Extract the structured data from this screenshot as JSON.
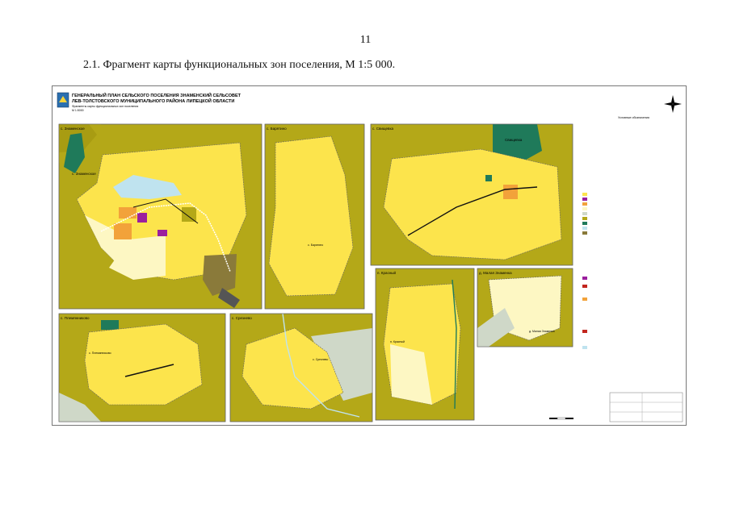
{
  "page_number": "11",
  "caption": "2.1.    Фрагмент карты функциональных зон поселения, М 1:5 000.",
  "header": {
    "line1": "ГЕНЕРАЛЬНЫЙ ПЛАН СЕЛЬСКОГО ПОСЕЛЕНИЯ ЗНАМЕНСКИЙ СЕЛЬСОВЕТ",
    "line2": "ЛЕВ-ТОЛСТОВСКОГО МУНИЦИПАЛЬНОГО РАЙОНА ЛИПЕЦКОЙ ОБЛАСТИ",
    "line3": "Фрагменты карты функциональных зон поселения",
    "line4": "М 1:5000"
  },
  "panels": {
    "znamenskoe": {
      "title": "с. Знаменское",
      "label": "с. Знаменское"
    },
    "baryatino": {
      "title": "с. Барятино",
      "label": "с. Барятино"
    },
    "svishchevka": {
      "title": "с. Свищевка",
      "label": "Свищевка"
    },
    "krasnyi": {
      "title": "п. Красный",
      "label": "п. Красный"
    },
    "malaya": {
      "title": "д. Малая Знаменка",
      "label": "д. Малая Знаменка"
    },
    "plemyannikovo": {
      "title": "с. Племянниково",
      "label": "с. Племянниково"
    },
    "sreznevo": {
      "title": "с. Срезнево",
      "label": "с. Срезнево"
    }
  },
  "legend": {
    "title": "Условные обозначения"
  },
  "colors": {
    "olive": "#b4a818",
    "yellow": "#fce44c",
    "pale": "#fdf7c3",
    "forest": "#1f7a5a",
    "water": "#bfe3ef",
    "orange": "#f2a23a",
    "purple": "#9b1f9e",
    "grey": "#cfd8c8",
    "brown": "#8a7a3a"
  }
}
